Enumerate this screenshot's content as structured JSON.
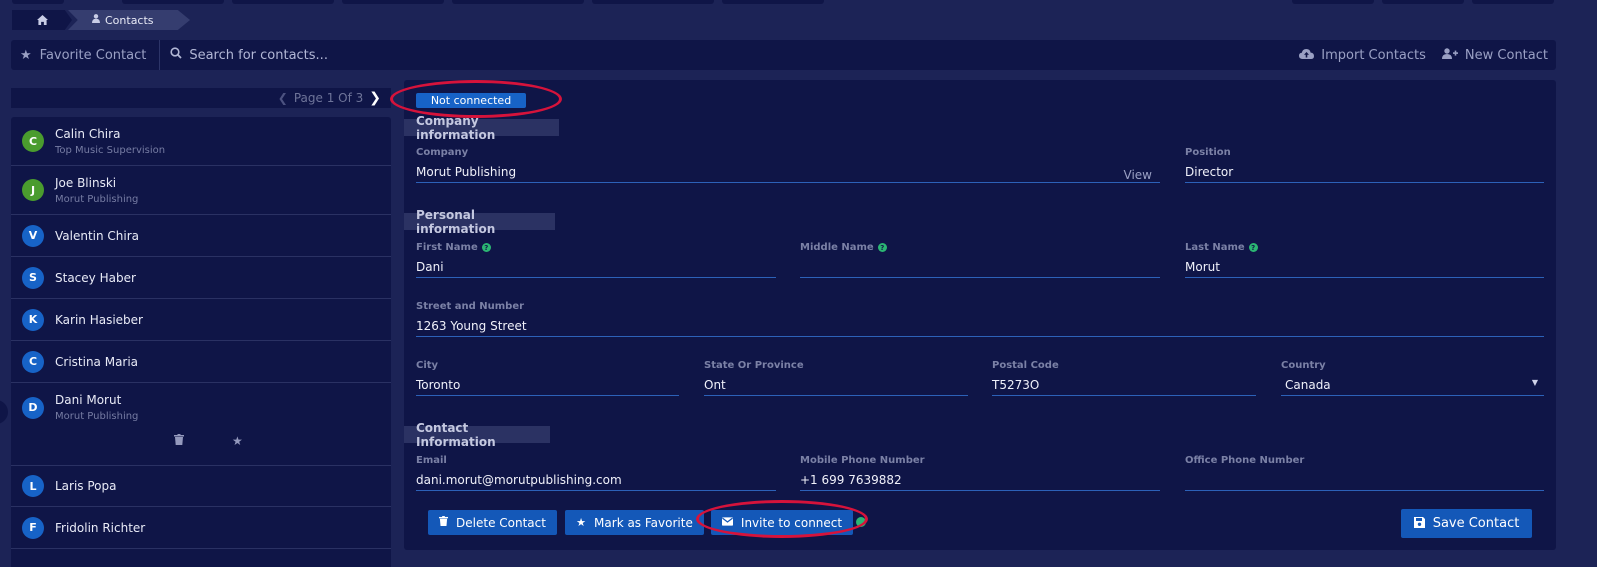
{
  "breadcrumb": {
    "home_icon": "home-icon",
    "contacts_icon": "user-icon",
    "contacts_label": "Contacts"
  },
  "toolbar": {
    "favorite_label": "Favorite Contact",
    "search_placeholder": "Search for contacts...",
    "import_label": "Import Contacts",
    "new_label": "New Contact"
  },
  "pagination": {
    "label": "Page 1 Of 3"
  },
  "contacts": [
    {
      "initial": "C",
      "name": "Calin Chira",
      "sub": "Top Music Supervision",
      "color": "#4a9c2e"
    },
    {
      "initial": "J",
      "name": "Joe Blinski",
      "sub": "Morut Publishing",
      "color": "#4a9c2e"
    },
    {
      "initial": "V",
      "name": "Valentin Chira",
      "sub": "",
      "color": "#1763c7"
    },
    {
      "initial": "S",
      "name": "Stacey Haber",
      "sub": "",
      "color": "#1763c7"
    },
    {
      "initial": "K",
      "name": "Karin Hasieber",
      "sub": "",
      "color": "#1763c7"
    },
    {
      "initial": "C",
      "name": "Cristina Maria",
      "sub": "",
      "color": "#1763c7"
    },
    {
      "initial": "D",
      "name": "Dani Morut",
      "sub": "Morut Publishing",
      "color": "#1763c7"
    },
    {
      "initial": "L",
      "name": "Laris Popa",
      "sub": "",
      "color": "#1763c7"
    },
    {
      "initial": "F",
      "name": "Fridolin Richter",
      "sub": "",
      "color": "#1763c7"
    }
  ],
  "status": {
    "label": "Not connected",
    "color": "#1763c7"
  },
  "sections": {
    "company": "Company information",
    "personal": "Personal information",
    "contact": "Contact Information"
  },
  "fields": {
    "company": {
      "label": "Company",
      "value": "Morut Publishing",
      "link": "View"
    },
    "position": {
      "label": "Position",
      "value": "Director"
    },
    "first_name": {
      "label": "First Name",
      "value": "Dani"
    },
    "middle_name": {
      "label": "Middle Name",
      "value": ""
    },
    "last_name": {
      "label": "Last Name",
      "value": "Morut"
    },
    "street": {
      "label": "Street and Number",
      "value": "1263 Young Street"
    },
    "city": {
      "label": "City",
      "value": "Toronto"
    },
    "state": {
      "label": "State Or Province",
      "value": "Ont"
    },
    "postal": {
      "label": "Postal Code",
      "value": "T5273O"
    },
    "country": {
      "label": "Country",
      "value": "Canada"
    },
    "email": {
      "label": "Email",
      "value": "dani.morut@morutpublishing.com"
    },
    "mobile": {
      "label": "Mobile Phone Number",
      "value": "+1  699 7639882"
    },
    "office": {
      "label": "Office Phone Number",
      "value": ""
    }
  },
  "buttons": {
    "delete": "Delete Contact",
    "favorite": "Mark as Favorite",
    "invite": "Invite to connect",
    "save": "Save Contact"
  },
  "colors": {
    "annotation": "#d6133b",
    "accent": "#1458b8",
    "help": "#2bb673"
  }
}
